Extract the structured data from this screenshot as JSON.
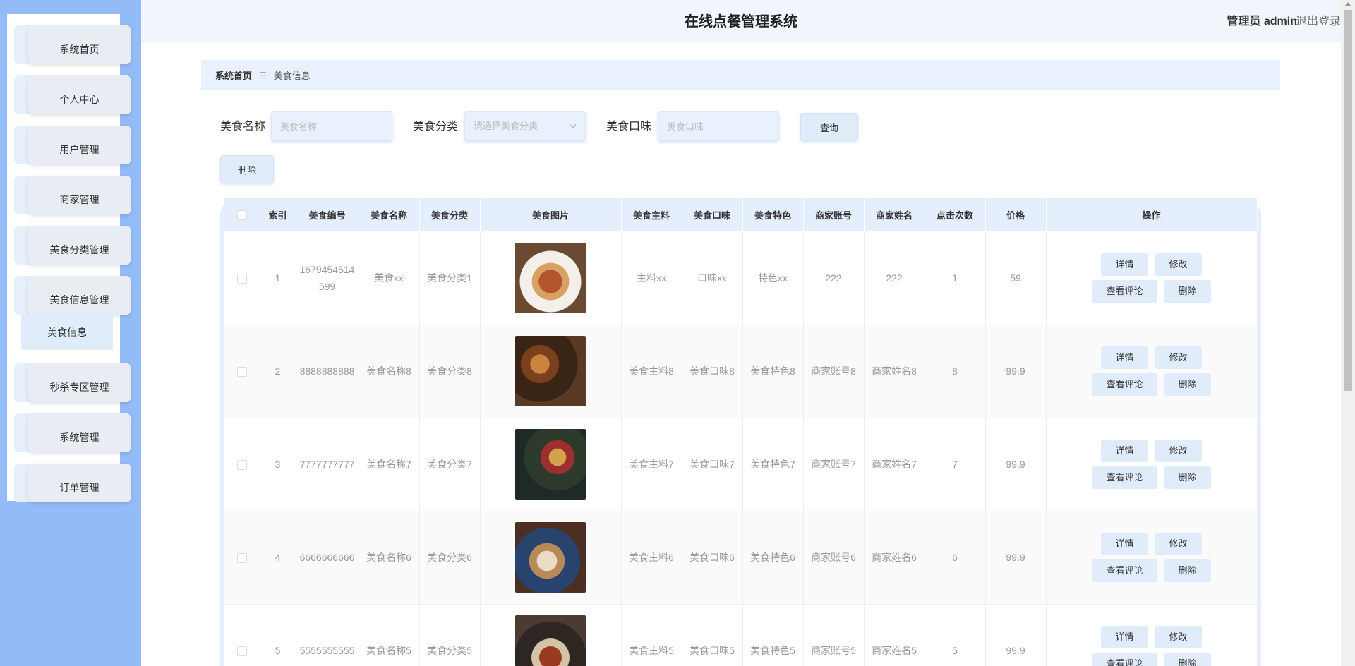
{
  "header": {
    "title": "在线点餐管理系统",
    "user": "管理员 admin",
    "logout": "退出登录"
  },
  "sidebar": {
    "items": [
      {
        "label": "系统首页"
      },
      {
        "label": "个人中心"
      },
      {
        "label": "用户管理"
      },
      {
        "label": "商家管理"
      },
      {
        "label": "美食分类管理"
      },
      {
        "label": "美食信息管理"
      },
      {
        "label": "秒杀专区管理"
      },
      {
        "label": "系统管理"
      },
      {
        "label": "订单管理"
      }
    ],
    "sub_item": "美食信息"
  },
  "breadcrumb": {
    "home": "系统首页",
    "separator": "☰",
    "current": "美食信息"
  },
  "search": {
    "name_label": "美食名称",
    "name_placeholder": "美食名称",
    "category_label": "美食分类",
    "category_placeholder": "请选择美食分类",
    "taste_label": "美食口味",
    "taste_placeholder": "美食口味",
    "query_button": "查询",
    "delete_button": "删除"
  },
  "table": {
    "headers": [
      "索引",
      "美食编号",
      "美食名称",
      "美食分类",
      "美食图片",
      "美食主料",
      "美食口味",
      "美食特色",
      "商家账号",
      "商家姓名",
      "点击次数",
      "价格",
      "操作"
    ],
    "actions": {
      "detail": "详情",
      "edit": "修改",
      "comments": "查看评论",
      "delete": "删除"
    },
    "rows": [
      {
        "index": "1",
        "code": "1679454514599",
        "name": "美食xx",
        "category": "美食分类1",
        "ingredient": "主料xx",
        "taste": "口味xx",
        "feature": "特色xx",
        "merchant_account": "222",
        "merchant_name": "222",
        "clicks": "1",
        "price": "59"
      },
      {
        "index": "2",
        "code": "8888888888",
        "name": "美食名称8",
        "category": "美食分类8",
        "ingredient": "美食主料8",
        "taste": "美食口味8",
        "feature": "美食特色8",
        "merchant_account": "商家账号8",
        "merchant_name": "商家姓名8",
        "clicks": "8",
        "price": "99.9"
      },
      {
        "index": "3",
        "code": "7777777777",
        "name": "美食名称7",
        "category": "美食分类7",
        "ingredient": "美食主料7",
        "taste": "美食口味7",
        "feature": "美食特色7",
        "merchant_account": "商家账号7",
        "merchant_name": "商家姓名7",
        "clicks": "7",
        "price": "99.9"
      },
      {
        "index": "4",
        "code": "6666666666",
        "name": "美食名称6",
        "category": "美食分类6",
        "ingredient": "美食主料6",
        "taste": "美食口味6",
        "feature": "美食特色6",
        "merchant_account": "商家账号6",
        "merchant_name": "商家姓名6",
        "clicks": "6",
        "price": "99.9"
      },
      {
        "index": "5",
        "code": "5555555555",
        "name": "美食名称5",
        "category": "美食分类5",
        "ingredient": "美食主料5",
        "taste": "美食口味5",
        "feature": "美食特色5",
        "merchant_account": "商家账号5",
        "merchant_name": "商家姓名5",
        "clicks": "5",
        "price": "99.9"
      }
    ]
  },
  "colors": {
    "sidebar_bg": "#93bbf7",
    "accent_light": "#e4eefc",
    "button_bg": "#e1ecfb"
  }
}
